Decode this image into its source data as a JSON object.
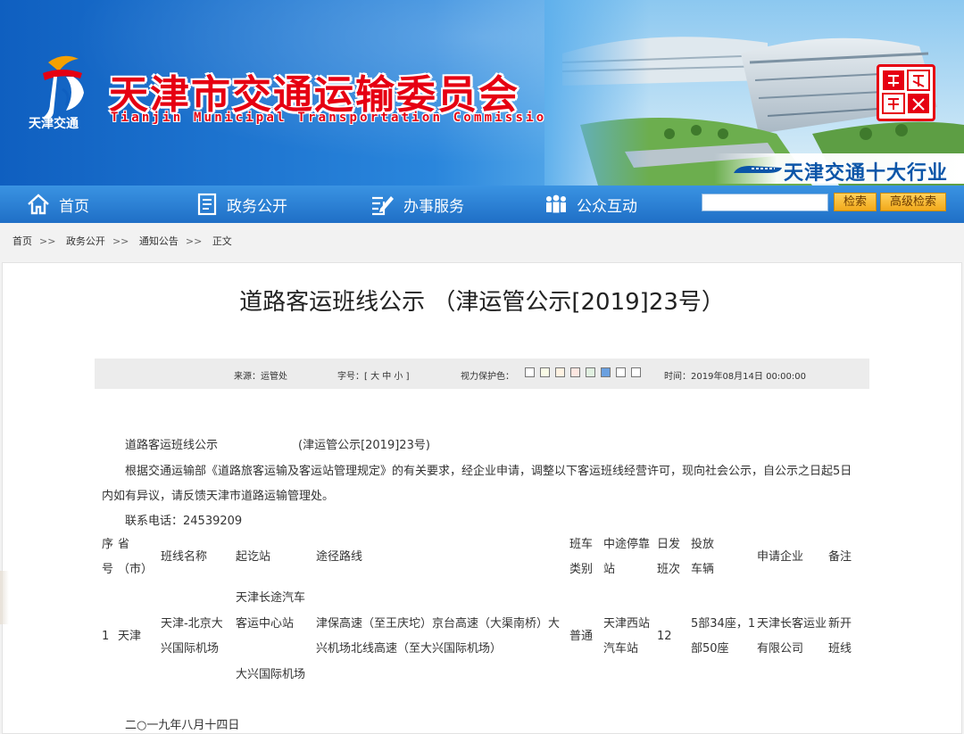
{
  "header": {
    "logo_text": "天津交通",
    "title": "天津市交通运输委员会",
    "subtitle": "Tianjin Municipal Transportation Commission",
    "slogan": "天津交通十大行业",
    "seal_text": "天津交通网"
  },
  "nav": {
    "items": [
      {
        "label": "首页",
        "icon": "home-icon"
      },
      {
        "label": "政务公开",
        "icon": "document-icon"
      },
      {
        "label": "办事服务",
        "icon": "edit-icon"
      },
      {
        "label": "公众互动",
        "icon": "people-icon"
      }
    ],
    "search_placeholder": "",
    "search_button": "检索",
    "advanced_search_button": "高级检索"
  },
  "breadcrumb": [
    "首页",
    "政务公开",
    "通知公告",
    "正文"
  ],
  "breadcrumb_sep": ">>",
  "article": {
    "title": "道路客运班线公示 （津运管公示[2019]23号）",
    "source": "来源：运管处",
    "font_size": "字号：[ 大 中 小 ]",
    "eye_color_label": "视力保护色：",
    "eye_colors": [
      "#ffffff",
      "#fafbe6",
      "#fff2e2",
      "#fde6e0",
      "#e1f0e1",
      "#6aa0e0",
      "#ffffff",
      "#ffffff"
    ],
    "time": "时间：2019年08月14日 00:00:00",
    "para_title": "道路客运班线公示",
    "para_title_num": "(津运管公示[2019]23号)",
    "para_body_1": "根据交通运输部《道路旅客运输及客运站管理规定》的有关要求，经企业申请，调整以下客运班线经营许可，现向社会公示，自公示之日起5日",
    "para_body_2": "内如有异议，请反馈天津市道路运输管理处。",
    "contact": "联系电话：24539209",
    "date": "二○一九年八月十四日"
  },
  "table": {
    "headers": {
      "no_1": "序",
      "no_2": "号",
      "prov_1": "省",
      "prov_2": "（市）",
      "line_name": "班线名称",
      "stations": "起讫站",
      "route": "途径路线",
      "type_1": "班车",
      "type_2": "类别",
      "stop_1": "中途停靠",
      "stop_2": "站",
      "daily_1": "日发",
      "daily_2": "班次",
      "vehicle_1": "投放",
      "vehicle_2": "车辆",
      "company": "申请企业",
      "remark": "备注"
    },
    "row": {
      "no": "1",
      "prov": "天津",
      "line_1": "天津-北京大",
      "line_2": "兴国际机场",
      "start_1": "天津长途汽车",
      "start_2": "客运中心站",
      "end": "大兴国际机场",
      "route_1": "津保高速（至王庆坨）京台高速（大渠南桥）大",
      "route_2": "兴机场北线高速（至大兴国际机场）",
      "type": "普通",
      "stop_1": "天津西站",
      "stop_2": "汽车站",
      "daily": "12",
      "vehicle_1": "5部34座，1",
      "vehicle_2": "部50座",
      "company_1": "天津长客运业",
      "company_2": "有限公司",
      "remark_1": "新开",
      "remark_2": "班线"
    }
  }
}
